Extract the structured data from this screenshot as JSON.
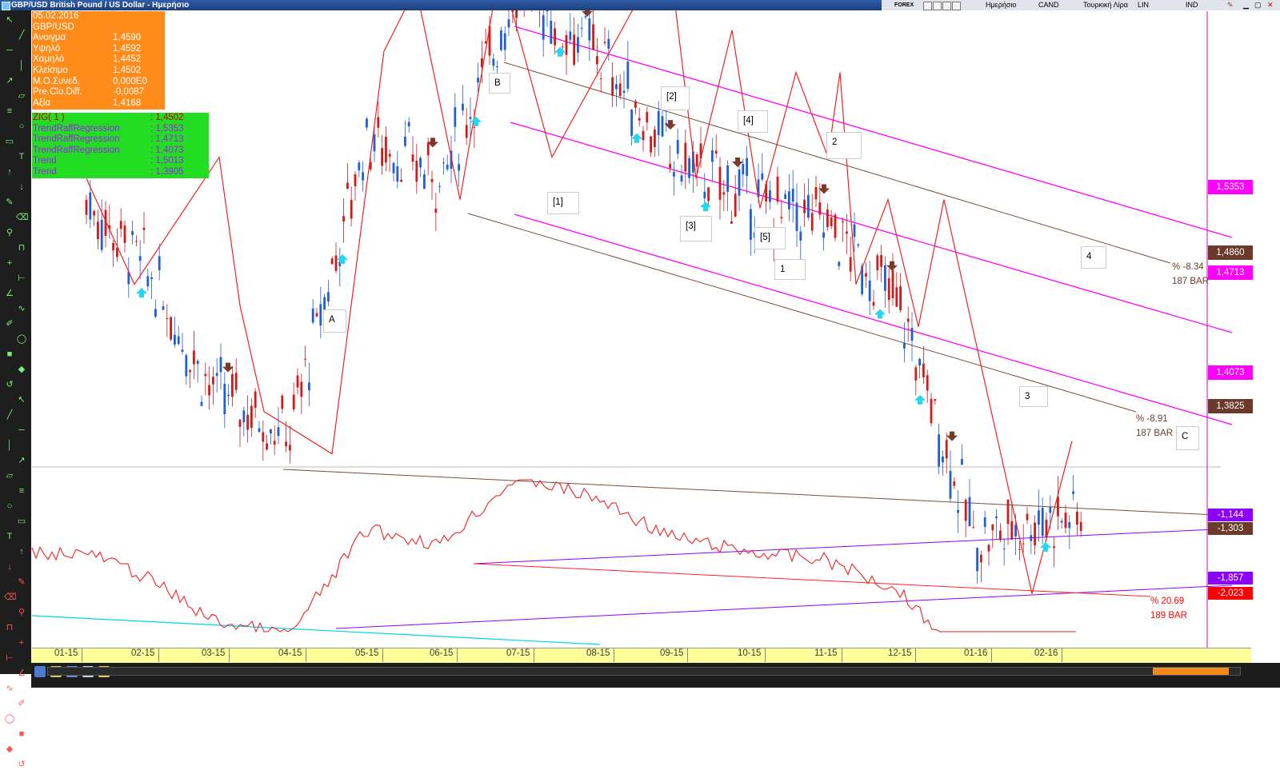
{
  "window": {
    "title": "GBP/USD British Pound / US Dollar - Ημερήσιο"
  },
  "top_controls": {
    "source": "FOREX",
    "period": "Ημερήσιο",
    "chart_style": "CAND",
    "currency": "Τουρκική Λίρα",
    "scale": "LIN",
    "indicator": "IND"
  },
  "quote": {
    "date": "05.02.2016",
    "symbol": "GBP/USD",
    "rows": [
      {
        "label": "Ανοιγμα",
        "value": "1,4590"
      },
      {
        "label": "Υψηλό",
        "value": "1,4592"
      },
      {
        "label": "Χαμηλό",
        "value": "1,4452"
      },
      {
        "label": "Κλείσιμο",
        "value": "1,4502"
      },
      {
        "label": "Μ.Ο.Συνεδ.",
        "value": "0,000E0"
      },
      {
        "label": "Pre.Clo.Diff.",
        "value": "-0,0087"
      },
      {
        "label": "Αξία",
        "value": "1,4168"
      }
    ]
  },
  "indicators": [
    {
      "label": "ZIG( 1 )",
      "value": ": 1,4502",
      "color": "#cc0000"
    },
    {
      "label": "TrendRaffRegression",
      "value": ": 1,5353",
      "color": "#a020f0"
    },
    {
      "label": "TrendRaffRegression",
      "value": ": 1,4713",
      "color": "#a020f0"
    },
    {
      "label": "TrendRaffRegression",
      "value": ": 1,4073",
      "color": "#a020f0"
    },
    {
      "label": "Trend",
      "value": ": 1,5013",
      "color": "#a020f0"
    },
    {
      "label": "Trend",
      "value": ": 1,3905",
      "color": "#a020f0"
    }
  ],
  "wave_labels": [
    "B",
    "[2]",
    "[4]",
    "2",
    "[1]",
    "[3]",
    "[5]",
    "1",
    "A",
    "4",
    "3",
    "C"
  ],
  "price_labels": [
    {
      "text": "1,5353",
      "bg": "#ff00ff"
    },
    {
      "text": "1,4860",
      "bg": "#6b3a2a"
    },
    {
      "text": "1,4713",
      "bg": "#ff00ff"
    },
    {
      "text": "1,4073",
      "bg": "#ff00ff"
    },
    {
      "text": "1,3825",
      "bg": "#6b3a2a"
    }
  ],
  "osc_labels": [
    {
      "text": "-1,144",
      "bg": "#8b00ff"
    },
    {
      "text": "-1,303",
      "bg": "#6b3a2a"
    },
    {
      "text": "-1,857",
      "bg": "#8b00ff"
    },
    {
      "text": "-2,023",
      "bg": "#ff0000"
    }
  ],
  "annotations": [
    {
      "pct": "% -8.34",
      "bars": "187 BAR",
      "color": "#6b3a2a"
    },
    {
      "pct": "% -8.91",
      "bars": "187 BAR",
      "color": "#6b3a2a"
    },
    {
      "pct": "% 20.69",
      "bars": "189 BAR",
      "color": "#ff0000"
    }
  ],
  "chart_data": {
    "type": "candlestick",
    "instrument": "GBP/USD",
    "period": "daily",
    "x_ticks": [
      "01-15",
      "02-15",
      "03-15",
      "04-15",
      "05-15",
      "06-15",
      "07-15",
      "08-15",
      "09-15",
      "10-15",
      "11-15",
      "12-15",
      "01-16",
      "02-16"
    ],
    "price_path": [
      [
        "01-15",
        1.53
      ],
      [
        "02-15",
        1.51
      ],
      [
        "03-15",
        1.48
      ],
      [
        "04-15",
        1.47
      ],
      [
        "05-15",
        1.54
      ],
      [
        "06-15",
        1.53
      ],
      [
        "07-15",
        1.575
      ],
      [
        "08-15",
        1.56
      ],
      [
        "09-15",
        1.535
      ],
      [
        "10-15",
        1.525
      ],
      [
        "11-15",
        1.52
      ],
      [
        "12-15",
        1.5
      ],
      [
        "01-16",
        1.445
      ],
      [
        "02-16",
        1.4502
      ]
    ],
    "last": {
      "open": 1.459,
      "high": 1.4592,
      "low": 1.4452,
      "close": 1.4502
    },
    "regression_levels": [
      1.5353,
      1.4713,
      1.4073
    ],
    "trend_levels": [
      1.5013,
      1.3905
    ],
    "oscillator_levels": [
      -1.144,
      -1.303,
      -1.857,
      -2.023
    ]
  }
}
